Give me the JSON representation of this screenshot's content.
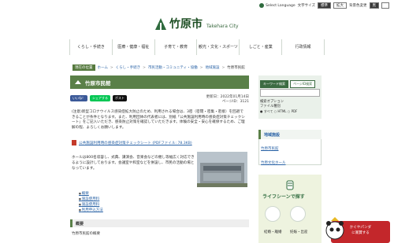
{
  "header": {
    "logo_text": "竹原市",
    "logo_sub": "Takehara City",
    "top_links": {
      "select_language": "Select Language",
      "text_size": "文字サイズ",
      "std": "標準",
      "large": "拡大",
      "bg_color": "背景色変更",
      "bg_btn_label": "黒"
    }
  },
  "nav": [
    "くらし・手続き",
    "医療・健康・福祉",
    "子育て・教育",
    "観光・文化・スポーツ",
    "しごと・産業",
    "行政情報"
  ],
  "breadcrumb": {
    "current_label": "現在の位置",
    "items": [
      "ホーム",
      "くらし・手続き",
      "市民活動・コミュニティ・協働",
      "地域施設",
      "竹原市民館"
    ]
  },
  "page": {
    "title": "竹原市民館",
    "share": {
      "fb": "いいね！",
      "x": "シェアする",
      "line": "ポスト"
    },
    "updated": "更新日：2022年01月14日",
    "page_id": "ページID：3121",
    "body": "(注意)新型コロナウイルス感染症拡大防止のため、利用される場合は、3密（密閉・密集・密接）を回避できることが条件となります。また、利用団体の代表者には、別紙「公共施設利用時の感染症対策チェックシート」をご記入いただき、感染防止対策を確認していただきます。体験の安全・安心を確保するため、ご理解の程、よろしくお願いします。",
    "pdf_link": "公共施設利用時の感染症対策チェックシート (PDFファイル: 78.3KB)",
    "photo_caption": "ホールは800名収容し、式典、講演会、音楽会などの催し等幅広く対応できるように設計しております。会議室や和室などを併設し、市民の活動の場となっています。",
    "links": [
      "概要",
      "施設使用料",
      "施設使用料",
      "利用申込方法"
    ],
    "section_title": "概要",
    "overview_label": "竹原市民館の概要"
  },
  "sidebar": {
    "tabs": [
      "キーワード検索",
      "ページID検索"
    ],
    "search_label": "検索オプション",
    "file_format": "ファイル種別",
    "radios": [
      "すべて",
      "HTML",
      "PDF"
    ],
    "section_title": "地域施設",
    "links": [
      "竹原市民館",
      "竹原文化ホール"
    ],
    "life_title": "ライフシーンで探す",
    "life_items": [
      "結婚・離婚",
      "妊娠・出産"
    ]
  },
  "banner": {
    "line1": "かぐやパンダ",
    "line2": "に賞賛する"
  },
  "colors": {
    "brand": "#5a8048",
    "link": "#2a63a6",
    "banner": "#c3272b"
  }
}
